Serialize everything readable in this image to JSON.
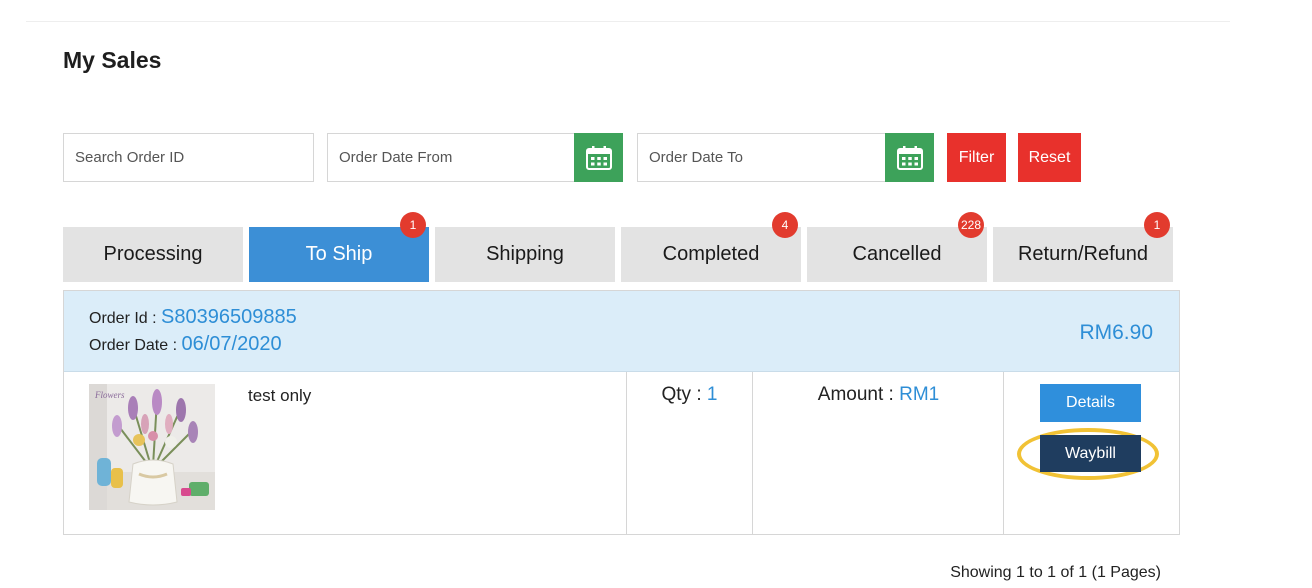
{
  "page": {
    "title": "My Sales"
  },
  "filters": {
    "search_placeholder": "Search Order ID",
    "date_from_placeholder": "Order Date From",
    "date_to_placeholder": "Order Date To",
    "filter_label": "Filter",
    "reset_label": "Reset"
  },
  "tabs": [
    {
      "label": "Processing",
      "badge": null,
      "active": false
    },
    {
      "label": "To Ship",
      "badge": "1",
      "active": true
    },
    {
      "label": "Shipping",
      "badge": null,
      "active": false
    },
    {
      "label": "Completed",
      "badge": "4",
      "active": false
    },
    {
      "label": "Cancelled",
      "badge": "228",
      "active": false
    },
    {
      "label": "Return/Refund",
      "badge": "1",
      "active": false
    }
  ],
  "order": {
    "id_label": "Order Id :",
    "id": "S80396509885",
    "date_label": "Order Date :",
    "date": "06/07/2020",
    "total": "RM6.90",
    "item": {
      "name": "test only",
      "qty_label": "Qty :",
      "qty": "1",
      "amount_label": "Amount :",
      "amount": "RM1"
    },
    "actions": {
      "details_label": "Details",
      "waybill_label": "Waybill"
    }
  },
  "pagination": {
    "text": "Showing 1 to 1 of 1 (1 Pages)"
  },
  "colors": {
    "accent_blue": "#3c8fd6",
    "calendar_green": "#3da25a",
    "button_red": "#e8312c",
    "badge_red": "#e23b2e",
    "waybill_navy": "#1f3d5f",
    "highlight_ring": "#f1c235"
  },
  "icons": {
    "calendar": "calendar-icon"
  }
}
